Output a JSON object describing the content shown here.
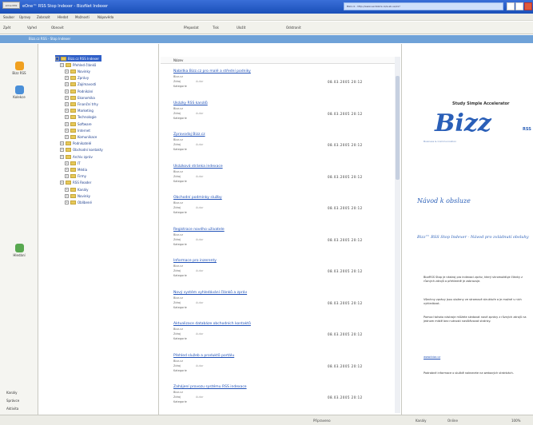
{
  "window": {
    "title": "eOne™ RSS Stop Indexer - BizzNet Indexer",
    "app_label": "eOne RSS",
    "address": "Bizz.cz - http://www.vecbizzni.cz/a.ab.ua/xx?"
  },
  "menu": [
    "Soubor",
    "Úpravy",
    "Zobrazit",
    "Hledat",
    "Možnosti",
    "Nápověda"
  ],
  "toolbar": {
    "back": "Zpět",
    "forward": "Vpřed",
    "refresh": "Obnovit",
    "items": [
      "Přeposlat",
      "Tisk",
      "Uložit"
    ],
    "dropdown": "Odstranit"
  },
  "breadcrumb": "Bizz.cz RSS - Stop Indexer",
  "left_nav": [
    {
      "label": "Bizz RSS",
      "icon": "rss-icon"
    },
    {
      "label": "Kolekce",
      "icon": "people-icon"
    },
    {
      "label": "Hledání",
      "icon": "search-icon"
    }
  ],
  "left_bottom": [
    "Kanály",
    "Správce",
    "Aktivita"
  ],
  "tree": [
    {
      "label": "Bizz.cz RSS Indexer",
      "level": 0,
      "selected": true
    },
    {
      "label": "Přehled článků",
      "level": 1
    },
    {
      "label": "Novinky",
      "level": 2
    },
    {
      "label": "Zprávy",
      "level": 2
    },
    {
      "label": "Zajímavosti",
      "level": 2
    },
    {
      "label": "Podnikání",
      "level": 2
    },
    {
      "label": "Ekonomika",
      "level": 2
    },
    {
      "label": "Finanční trhy",
      "level": 2
    },
    {
      "label": "Marketing",
      "level": 2
    },
    {
      "label": "Technologie",
      "level": 2
    },
    {
      "label": "Software",
      "level": 2
    },
    {
      "label": "Internet",
      "level": 2
    },
    {
      "label": "Komunikace",
      "level": 2
    },
    {
      "label": "Podnikatelé",
      "level": 1
    },
    {
      "label": "Obchodní kontakty",
      "level": 1
    },
    {
      "label": "Archiv zpráv",
      "level": 1
    },
    {
      "label": "IT",
      "level": 2
    },
    {
      "label": "Média",
      "level": 2
    },
    {
      "label": "Firmy",
      "level": 2
    },
    {
      "label": "RSS Reader",
      "level": 1
    },
    {
      "label": "Kanály",
      "level": 2
    },
    {
      "label": "Novinky",
      "level": 2
    },
    {
      "label": "Oblíbené",
      "level": 2
    }
  ],
  "messages": {
    "column": "Název",
    "items": [
      {
        "subject": "Nabídka Bizz.cz pro malé a střední podniky",
        "src": "Bizz.cz",
        "k1": "Zdroj",
        "k2": "Autor",
        "sub": "Kategorie",
        "date": "08.03.2005 20:12"
      },
      {
        "subject": "Ukázky RSS kanálů",
        "src": "Bizz.cz",
        "k1": "Zdroj",
        "k2": "Autor",
        "sub": "Kategorie",
        "date": "08.03.2005 20:12"
      },
      {
        "subject": "Zpravodaj Bizz.cz",
        "src": "Bizz.cz",
        "k1": "Zdroj",
        "k2": "Autor",
        "sub": "Kategorie",
        "date": "08.03.2005 20:12"
      },
      {
        "subject": "Ukázková stránka indexace",
        "src": "Bizz.cz",
        "k1": "Zdroj",
        "k2": "Autor",
        "sub": "Kategorie",
        "date": "08.03.2005 20:12"
      },
      {
        "subject": "Obchodní podmínky služby",
        "src": "Bizz.cz",
        "k1": "Zdroj",
        "k2": "Autor",
        "sub": "Kategorie",
        "date": "08.03.2005 20:12"
      },
      {
        "subject": "Registrace nového uživatele",
        "src": "Bizz.cz",
        "k1": "Zdroj",
        "k2": "Autor",
        "sub": "Kategorie",
        "date": "08.03.2005 20:12"
      },
      {
        "subject": "Informace pro inzerenty",
        "src": "Bizz.cz",
        "k1": "Zdroj",
        "k2": "Autor",
        "sub": "Kategorie",
        "date": "08.03.2005 20:12"
      },
      {
        "subject": "Nový systém vyhledávání článků a zpráv",
        "src": "Bizz.cz",
        "k1": "Zdroj",
        "k2": "Autor",
        "sub": "Kategorie",
        "date": "08.03.2005 20:12"
      },
      {
        "subject": "Aktualizace databáze obchodních kontaktů",
        "src": "Bizz.cz",
        "k1": "Zdroj",
        "k2": "Autor",
        "sub": "Kategorie",
        "date": "08.03.2005 20:12"
      },
      {
        "subject": "Přehled služeb a produktů portálu",
        "src": "Bizz.cz",
        "k1": "Zdroj",
        "k2": "Autor",
        "sub": "Kategorie",
        "date": "08.03.2005 20:12"
      },
      {
        "subject": "Zahájení provozu systému RSS indexace",
        "src": "Bizz.cz",
        "k1": "Zdroj",
        "k2": "Autor",
        "sub": "Kategorie",
        "date": "08.03.2005 20:12"
      }
    ]
  },
  "preview": {
    "tagline": "Study Simple Accelerator",
    "logo": "Bizz",
    "logo_sub": "Business & Communication",
    "rss_badge": "RSS",
    "heading": "Návod k obsluze",
    "intro": "Bizz™ RSS Stop Indexer - Návod pro zvládnutí obsluhy",
    "para1": "BizzRSS Stop je nástroj pro indexaci zpráv, který shromažďuje články z různých zdrojů a přehledně je zobrazuje.",
    "para2": "Všechny zprávy jsou uloženy ve stromové struktuře a je možné v nich vyhledávat.",
    "para3": "Pomocí tohoto nástroje můžete sledovat nové zprávy z různých zdrojů na jednom místě bez nutnosti navštěvovat stránky.",
    "link": "www.bizz.cz",
    "para4": "Podrobné informace o službě naleznete na webových stránkách."
  },
  "status": {
    "left": "Připraveno",
    "mid": "Kanály",
    "right": "Online",
    "far": "100%"
  }
}
